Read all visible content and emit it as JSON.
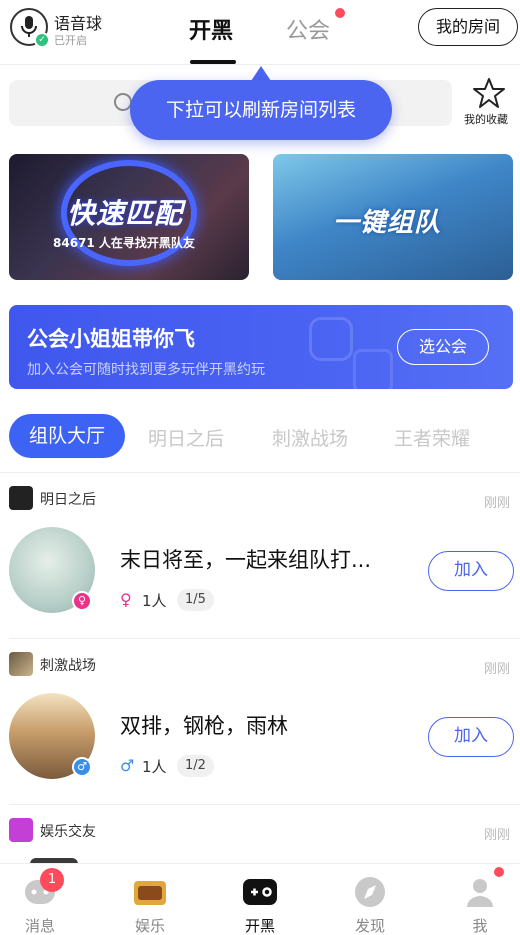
{
  "header": {
    "voice_ball_title": "语音球",
    "voice_ball_status": "已开启",
    "tabs": [
      {
        "label": "开黑"
      },
      {
        "label": "公会"
      }
    ],
    "my_room_label": "我的房间"
  },
  "search": {
    "favorites_label": "我的收藏",
    "tooltip": "下拉可以刷新房间列表"
  },
  "banners": {
    "quick_match_title": "快速匹配",
    "quick_match_sub": "84671 人在寻找开黑队友",
    "team_up_title": "一键组队"
  },
  "guild_banner": {
    "title": "公会小姐姐带你飞",
    "subtitle": "加入公会可随时找到更多玩伴开黑约玩",
    "button": "选公会"
  },
  "categories": [
    "组队大厅",
    "明日之后",
    "刺激战场",
    "王者荣耀"
  ],
  "rooms": [
    {
      "game": "明日之后",
      "time": "刚刚",
      "title": "末日将至，一起来组队打...",
      "sex_symbol": "♀",
      "people": "1人",
      "slots": "1/5",
      "join": "加入"
    },
    {
      "game": "刺激战场",
      "time": "刚刚",
      "title": "双排，钢枪，雨林",
      "sex_symbol": "♂",
      "people": "1人",
      "slots": "1/2",
      "join": "加入"
    },
    {
      "game": "娱乐交友",
      "time": "刚刚"
    }
  ],
  "bottom_nav": [
    {
      "label": "消息",
      "badge": "1"
    },
    {
      "label": "娱乐"
    },
    {
      "label": "开黑"
    },
    {
      "label": "发现"
    },
    {
      "label": "我"
    }
  ],
  "colors": {
    "accent": "#4b65f0",
    "badge": "#ff4b5c",
    "female": "#e8338a",
    "male": "#3a8ee8"
  }
}
